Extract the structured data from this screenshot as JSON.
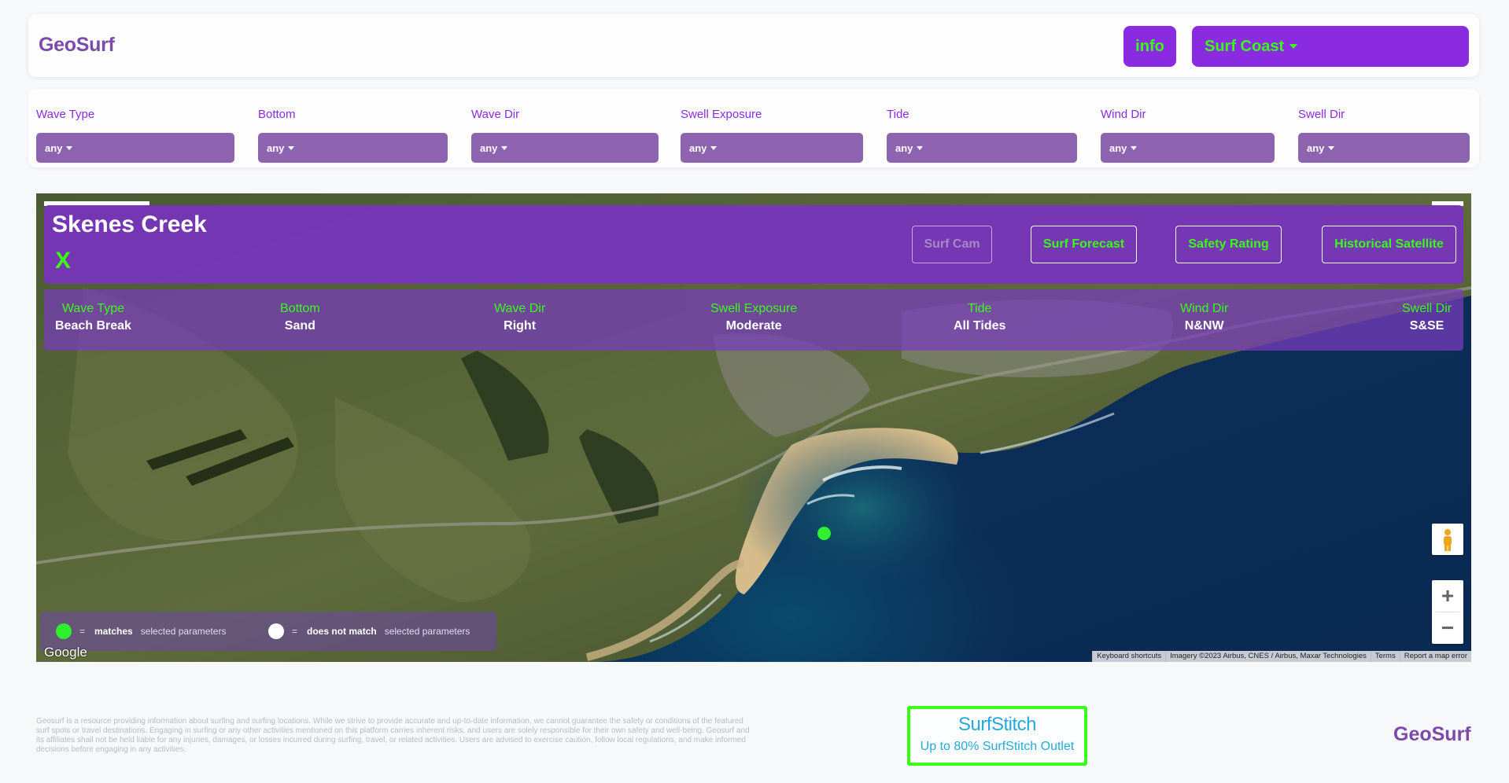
{
  "header": {
    "logo": "GeoSurf",
    "info_label": "info",
    "region_label": "Surf Coast"
  },
  "filters": [
    {
      "label": "Wave Type",
      "value": "any"
    },
    {
      "label": "Bottom",
      "value": "any"
    },
    {
      "label": "Wave Dir",
      "value": "any"
    },
    {
      "label": "Swell Exposure",
      "value": "any"
    },
    {
      "label": "Tide",
      "value": "any"
    },
    {
      "label": "Wind Dir",
      "value": "any"
    },
    {
      "label": "Swell Dir",
      "value": "any"
    }
  ],
  "spot": {
    "name": "Skenes Creek",
    "close_label": "X",
    "buttons": {
      "surf_cam": "Surf Cam",
      "surf_forecast": "Surf Forecast",
      "safety_rating": "Safety Rating",
      "historical_satellite": "Historical Satellite"
    },
    "attributes": [
      {
        "label": "Wave Type",
        "value": "Beach Break"
      },
      {
        "label": "Bottom",
        "value": "Sand"
      },
      {
        "label": "Wave Dir",
        "value": "Right"
      },
      {
        "label": "Swell Exposure",
        "value": "Moderate"
      },
      {
        "label": "Tide",
        "value": "All Tides"
      },
      {
        "label": "Wind Dir",
        "value": "N&NW"
      },
      {
        "label": "Swell Dir",
        "value": "S&SE"
      }
    ]
  },
  "legend": {
    "match_strong": "matches",
    "match_rest": "selected parameters",
    "nomatch_strong": "does not match",
    "nomatch_rest": "selected parameters",
    "equals": "="
  },
  "map": {
    "google_logo": "Google",
    "attribution": {
      "keyboard": "Keyboard shortcuts",
      "imagery": "Imagery ©2023 Airbus, CNES / Airbus, Maxar Technologies",
      "terms": "Terms",
      "report": "Report a map error"
    },
    "zoom_in": "+",
    "zoom_out": "−"
  },
  "footer": {
    "disclaimer": "Geosurf is a resource providing information about surfing and surfing locations. While we strive to provide accurate and up-to-date information, we cannot guarantee the safety or conditions of the featured surf spots or travel destinations. Engaging in surfing or any other activities mentioned on this platform carries inherent risks, and users are solely responsible for their own safety and well-being. Geosurf and its affiliates shall not be held liable for any injuries, damages, or losses incurred during surfing, travel, or related activities. Users are advised to exercise caution, follow local regulations, and make informed decisions before engaging in any activities.",
    "ad_brand": "SurfStitch",
    "ad_offer": "Up to 80% SurfStitch Outlet",
    "logo": "GeoSurf"
  },
  "colors": {
    "brand_purple": "#8a2be2",
    "accent_green": "#39ff14",
    "logo_purple": "#7c4aa8"
  }
}
